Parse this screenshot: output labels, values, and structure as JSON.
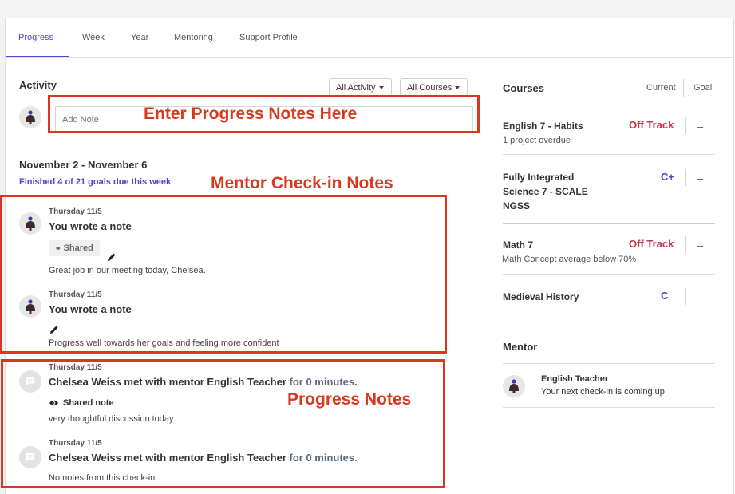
{
  "tabs": [
    {
      "label": "Progress"
    },
    {
      "label": "Week"
    },
    {
      "label": "Year"
    },
    {
      "label": "Mentoring"
    },
    {
      "label": "Support Profile"
    }
  ],
  "activity": {
    "title": "Activity",
    "filter_activity": "All Activity",
    "filter_courses": "All Courses",
    "note_placeholder": "Add Note"
  },
  "annotations": {
    "enter_notes": "Enter Progress Notes Here",
    "mentor_checkin": "Mentor Check-in Notes",
    "progress_notes": "Progress Notes"
  },
  "week": {
    "range": "November 2 - November 6",
    "goals": "Finished 4 of 21 goals due this week"
  },
  "entries": [
    {
      "date": "Thursday 11/5",
      "title": "You wrote a note",
      "shared": "Shared",
      "body": "Great job in our meeting today, Chelsea."
    },
    {
      "date": "Thursday 11/5",
      "title": "You wrote a note",
      "body": "Progress well towards her goals and feeling more confident"
    },
    {
      "date": "Thursday 11/5",
      "title_main": "Chelsea Weiss met with mentor English Teacher",
      "title_extra": "for 0 minutes.",
      "shared_note": "Shared note",
      "body": "very thoughtful discussion today"
    },
    {
      "date": "Thursday 11/5",
      "title_main": "Chelsea Weiss met with mentor English Teacher",
      "title_extra": "for 0 minutes.",
      "body": "No notes from this check-in"
    }
  ],
  "courses": {
    "title": "Courses",
    "col_current": "Current",
    "col_goal": "Goal",
    "items": [
      {
        "name": "English 7 - Habits",
        "status": "Off Track",
        "goal": "–",
        "sub": "1 project overdue"
      },
      {
        "name_lines": [
          "Fully Integrated",
          "Science 7 - SCALE",
          "NGSS"
        ],
        "grade": "C+",
        "goal": "–"
      },
      {
        "name": "Math 7",
        "status": "Off Track",
        "goal": "–",
        "sub": "Math Concept average below 70%"
      },
      {
        "name": "Medieval History",
        "grade": "C",
        "goal": "–"
      }
    ]
  },
  "mentor": {
    "title": "Mentor",
    "name": "English Teacher",
    "sub": "Your next check-in is coming up"
  },
  "colors": {
    "accent": "#4a46d6",
    "off_track": "#c8334e",
    "annotation": "#d9381e"
  }
}
